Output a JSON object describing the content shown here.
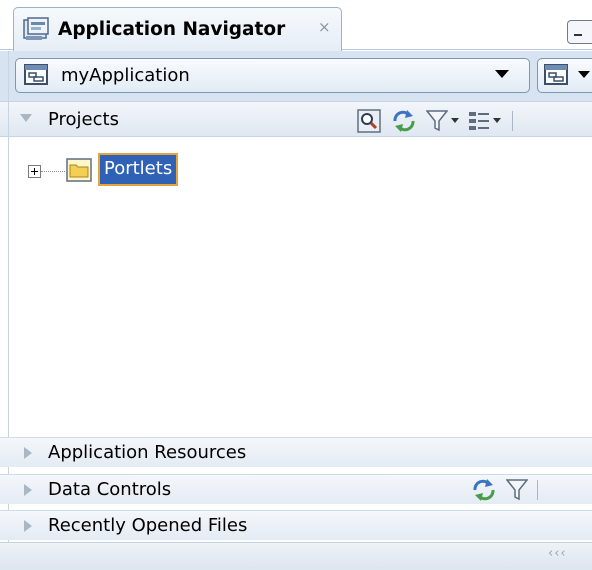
{
  "tab": {
    "title": "Application Navigator",
    "close_glyph": "×",
    "icon": "application-navigator-icon"
  },
  "window": {
    "minimize_icon": "minimize-icon"
  },
  "application": {
    "name": "myApplication",
    "dropdown_icon": "chevron-down-icon",
    "menu_icon": "application-menu-icon"
  },
  "projects": {
    "label": "Projects",
    "toolbar": [
      "find-icon",
      "refresh-icon",
      "filter-icon",
      "working-sets-icon"
    ],
    "tree": [
      {
        "label": "Portlets",
        "icon": "folder-icon",
        "selected": true,
        "expanded": false
      }
    ]
  },
  "panels": {
    "application_resources": "Application Resources",
    "data_controls": "Data Controls",
    "recently_opened_files": "Recently Opened Files"
  },
  "footer": {
    "scroll_glyph": "‹‹‹"
  },
  "colors": {
    "selection_bg": "#2f62b7",
    "selection_border": "#e9a33b",
    "header_bg": "#d7e3f1"
  }
}
